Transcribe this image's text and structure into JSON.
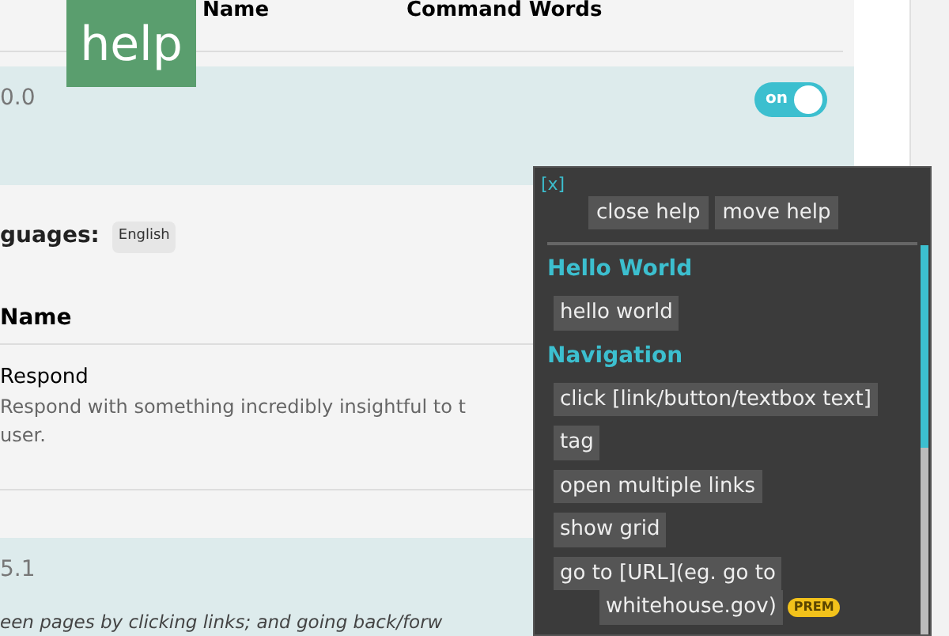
{
  "table_header": {
    "columns": [
      "Name",
      "Command Words"
    ]
  },
  "help_badge": "help",
  "plugins": [
    {
      "version": "0.0",
      "enabled": true
    },
    {
      "version": "5.1",
      "description": "een pages by clicking links; and going back/forw"
    }
  ],
  "details": {
    "languages_label": "guages:",
    "languages": [
      "English"
    ],
    "column": "Name",
    "commands": [
      {
        "name": "Respond",
        "description": "Respond with something incredibly insightful to t",
        "description_2": "user."
      }
    ]
  },
  "toggle_label": "on",
  "help_panel": {
    "close": "[x]",
    "buttons": [
      "close help",
      "move help"
    ],
    "sections": [
      {
        "title": "Hello World",
        "commands": [
          {
            "text": "hello world"
          }
        ]
      },
      {
        "title": "Navigation",
        "commands": [
          {
            "text": "click [link/button/textbox text]"
          },
          {
            "text": "tag"
          },
          {
            "text": "open multiple links"
          },
          {
            "text": "show grid"
          },
          {
            "text": "go to [URL](eg. go to",
            "text_2": "whitehouse.gov)",
            "badge": "PREM"
          }
        ]
      }
    ]
  }
}
